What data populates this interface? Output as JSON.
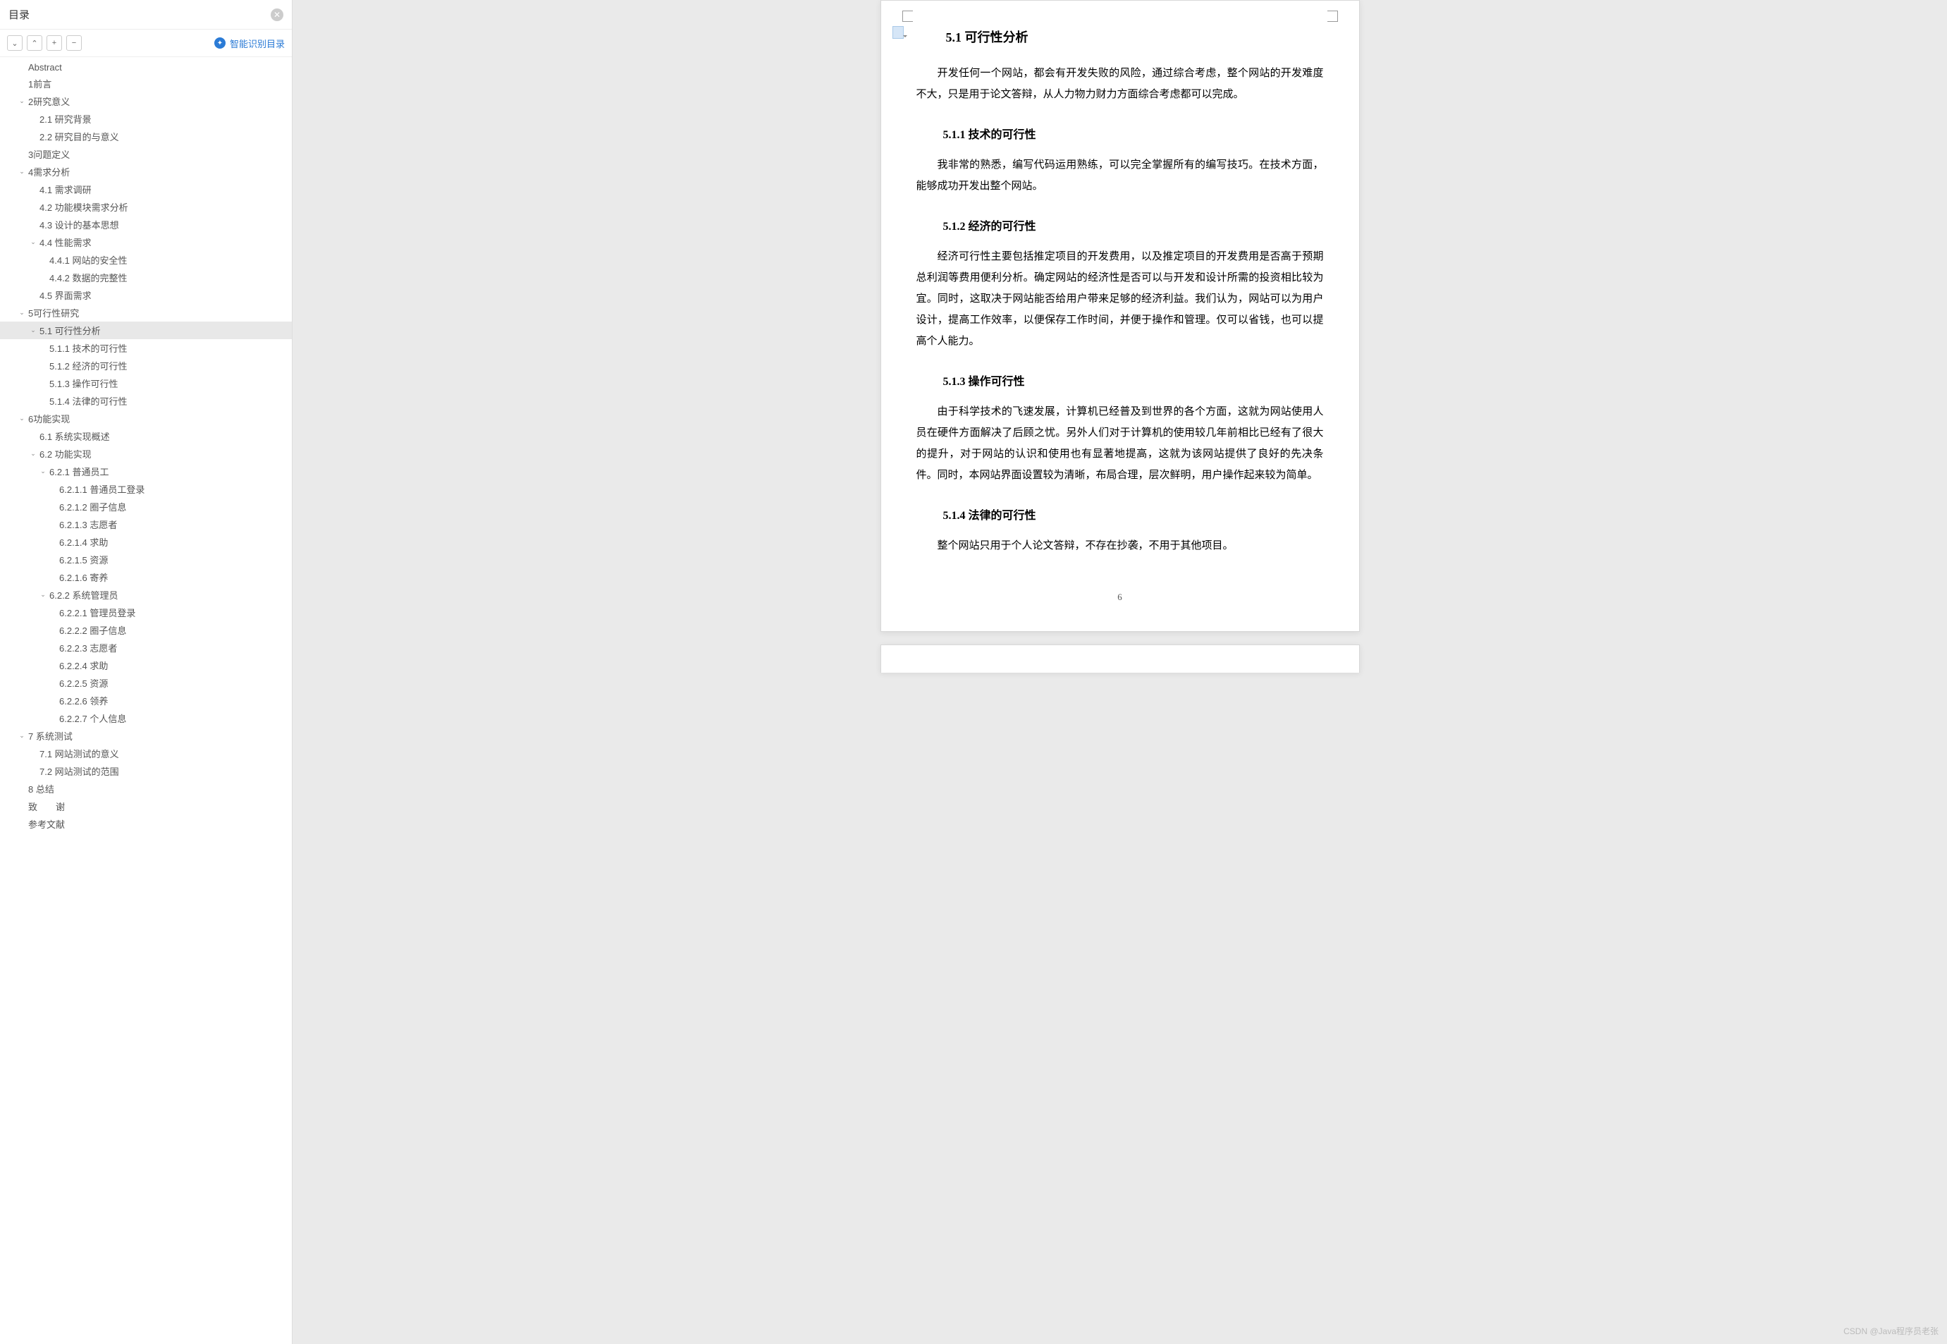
{
  "sidebar": {
    "title": "目录",
    "close_glyph": "✕",
    "toolbar": {
      "down": "⌄",
      "up": "⌃",
      "plus": "+",
      "minus": "−"
    },
    "smart_toc": "智能识别目录"
  },
  "toc": [
    {
      "label": "Abstract",
      "level": 1,
      "caret": ""
    },
    {
      "label": "1前言",
      "level": 1,
      "caret": ""
    },
    {
      "label": "2研究意义",
      "level": 1,
      "caret": "v"
    },
    {
      "label": "2.1 研究背景",
      "level": 2,
      "caret": ""
    },
    {
      "label": "2.2 研究目的与意义",
      "level": 2,
      "caret": ""
    },
    {
      "label": "3问题定义",
      "level": 1,
      "caret": ""
    },
    {
      "label": "4需求分析",
      "level": 1,
      "caret": "v"
    },
    {
      "label": "4.1 需求调研",
      "level": 2,
      "caret": ""
    },
    {
      "label": "4.2 功能模块需求分析",
      "level": 2,
      "caret": ""
    },
    {
      "label": "4.3 设计的基本思想",
      "level": 2,
      "caret": ""
    },
    {
      "label": "4.4 性能需求",
      "level": 2,
      "caret": "v"
    },
    {
      "label": "4.4.1 网站的安全性",
      "level": 3,
      "caret": ""
    },
    {
      "label": "4.4.2 数据的完整性",
      "level": 3,
      "caret": ""
    },
    {
      "label": "4.5 界面需求",
      "level": 2,
      "caret": ""
    },
    {
      "label": "5可行性研究",
      "level": 1,
      "caret": "v"
    },
    {
      "label": "5.1 可行性分析",
      "level": 2,
      "caret": "v",
      "active": true
    },
    {
      "label": "5.1.1 技术的可行性",
      "level": 3,
      "caret": ""
    },
    {
      "label": "5.1.2 经济的可行性",
      "level": 3,
      "caret": ""
    },
    {
      "label": "5.1.3 操作可行性",
      "level": 3,
      "caret": ""
    },
    {
      "label": "5.1.4 法律的可行性",
      "level": 3,
      "caret": ""
    },
    {
      "label": "6功能实现",
      "level": 1,
      "caret": "v"
    },
    {
      "label": "6.1 系统实现概述",
      "level": 2,
      "caret": ""
    },
    {
      "label": "6.2 功能实现",
      "level": 2,
      "caret": "v"
    },
    {
      "label": "6.2.1 普通员工",
      "level": 3,
      "caret": "v"
    },
    {
      "label": "6.2.1.1 普通员工登录",
      "level": 4,
      "caret": ""
    },
    {
      "label": "6.2.1.2 圈子信息",
      "level": 4,
      "caret": ""
    },
    {
      "label": "6.2.1.3 志愿者",
      "level": 4,
      "caret": ""
    },
    {
      "label": "6.2.1.4 求助",
      "level": 4,
      "caret": ""
    },
    {
      "label": "6.2.1.5 资源",
      "level": 4,
      "caret": ""
    },
    {
      "label": "6.2.1.6 寄养",
      "level": 4,
      "caret": ""
    },
    {
      "label": "6.2.2 系统管理员",
      "level": 3,
      "caret": "v"
    },
    {
      "label": "6.2.2.1 管理员登录",
      "level": 4,
      "caret": ""
    },
    {
      "label": "6.2.2.2 圈子信息",
      "level": 4,
      "caret": ""
    },
    {
      "label": "6.2.2.3 志愿者",
      "level": 4,
      "caret": ""
    },
    {
      "label": "6.2.2.4 求助",
      "level": 4,
      "caret": ""
    },
    {
      "label": "6.2.2.5 资源",
      "level": 4,
      "caret": ""
    },
    {
      "label": "6.2.2.6 领养",
      "level": 4,
      "caret": ""
    },
    {
      "label": "6.2.2.7 个人信息",
      "level": 4,
      "caret": ""
    },
    {
      "label": "7 系统测试",
      "level": 1,
      "caret": "v"
    },
    {
      "label": "7.1 网站测试的意义",
      "level": 2,
      "caret": ""
    },
    {
      "label": "7.2 网站测试的范围",
      "level": 2,
      "caret": ""
    },
    {
      "label": "8 总结",
      "level": 1,
      "caret": ""
    },
    {
      "label": "致　　谢",
      "level": 1,
      "caret": ""
    },
    {
      "label": "参考文献",
      "level": 1,
      "caret": ""
    }
  ],
  "doc": {
    "h51": "5.1 可行性分析",
    "p51": "开发任何一个网站，都会有开发失败的风险，通过综合考虑，整个网站的开发难度不大，只是用于论文答辩，从人力物力财力方面综合考虑都可以完成。",
    "h511": "5.1.1 技术的可行性",
    "p511": "我非常的熟悉，编写代码运用熟练，可以完全掌握所有的编写技巧。在技术方面，能够成功开发出整个网站。",
    "h512": "5.1.2 经济的可行性",
    "p512": "经济可行性主要包括推定项目的开发费用，以及推定项目的开发费用是否高于预期总利润等费用便利分析。确定网站的经济性是否可以与开发和设计所需的投资相比较为宜。同时，这取决于网站能否给用户带来足够的经济利益。我们认为，网站可以为用户设计，提高工作效率，以便保存工作时间，并便于操作和管理。仅可以省钱，也可以提高个人能力。",
    "h513": "5.1.3 操作可行性",
    "p513": "由于科学技术的飞速发展，计算机已经普及到世界的各个方面，这就为网站使用人员在硬件方面解决了后顾之忧。另外人们对于计算机的使用较几年前相比已经有了很大的提升，对于网站的认识和使用也有显著地提高，这就为该网站提供了良好的先决条件。同时，本网站界面设置较为清晰，布局合理，层次鲜明，用户操作起来较为简单。",
    "h514": "5.1.4 法律的可行性",
    "p514": "整个网站只用于个人论文答辩，不存在抄袭，不用于其他项目。",
    "page_num": "6"
  },
  "watermark": "CSDN @Java程序员老张"
}
